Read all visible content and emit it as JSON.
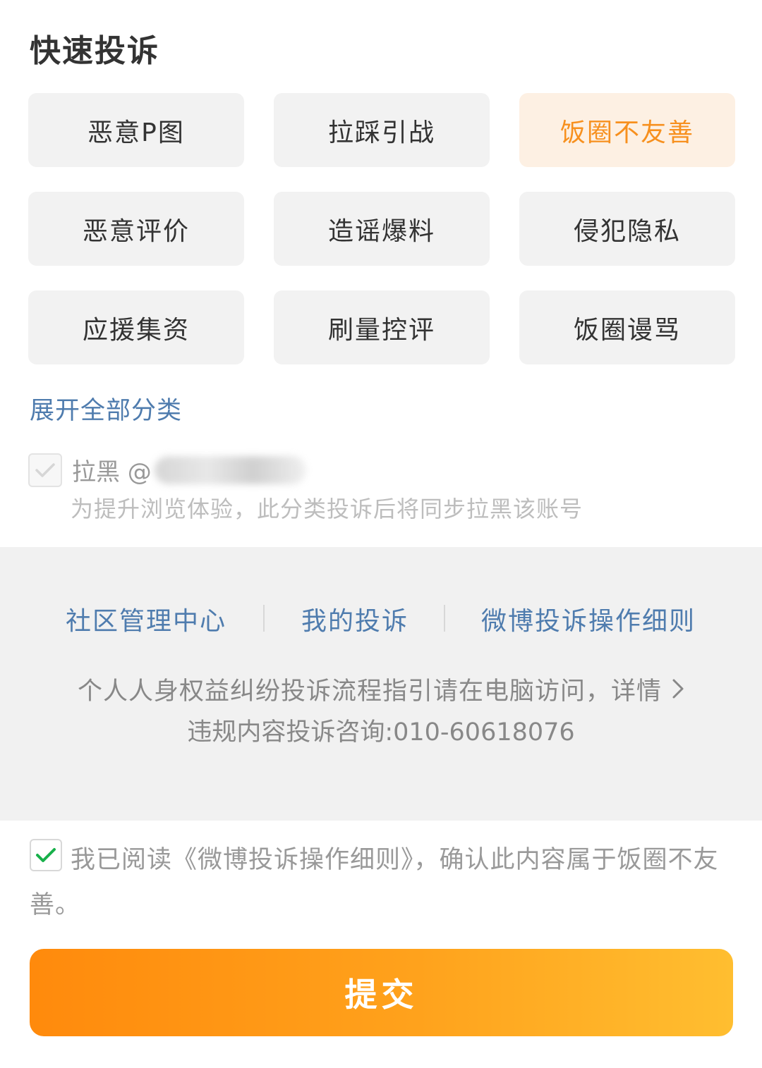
{
  "title": "快速投诉",
  "categories": [
    {
      "label": "恶意P图",
      "selected": false
    },
    {
      "label": "拉踩引战",
      "selected": false
    },
    {
      "label": "饭圈不友善",
      "selected": true
    },
    {
      "label": "恶意评价",
      "selected": false
    },
    {
      "label": "造谣爆料",
      "selected": false
    },
    {
      "label": "侵犯隐私",
      "selected": false
    },
    {
      "label": "应援集资",
      "selected": false
    },
    {
      "label": "刷量控评",
      "selected": false
    },
    {
      "label": "饭圈谩骂",
      "selected": false
    }
  ],
  "expand_label": "展开全部分类",
  "block": {
    "label": "拉黑 @",
    "note": "为提升浏览体验，此分类投诉后将同步拉黑该账号",
    "checked": true,
    "disabled": true
  },
  "footer_links": [
    "社区管理中心",
    "我的投诉",
    "微博投诉操作细则"
  ],
  "guide_text": "个人人身权益纠纷投诉流程指引请在电脑访问，详情",
  "hotline": "违规内容投诉咨询:010-60618076",
  "agreement": {
    "text": "我已阅读《微博投诉操作细则》，确认此内容属于饭圈不友善。",
    "checked": true
  },
  "submit_label": "提交",
  "colors": {
    "accent": "#f7901e",
    "link": "#4f7cae",
    "check": "#18b04a"
  }
}
